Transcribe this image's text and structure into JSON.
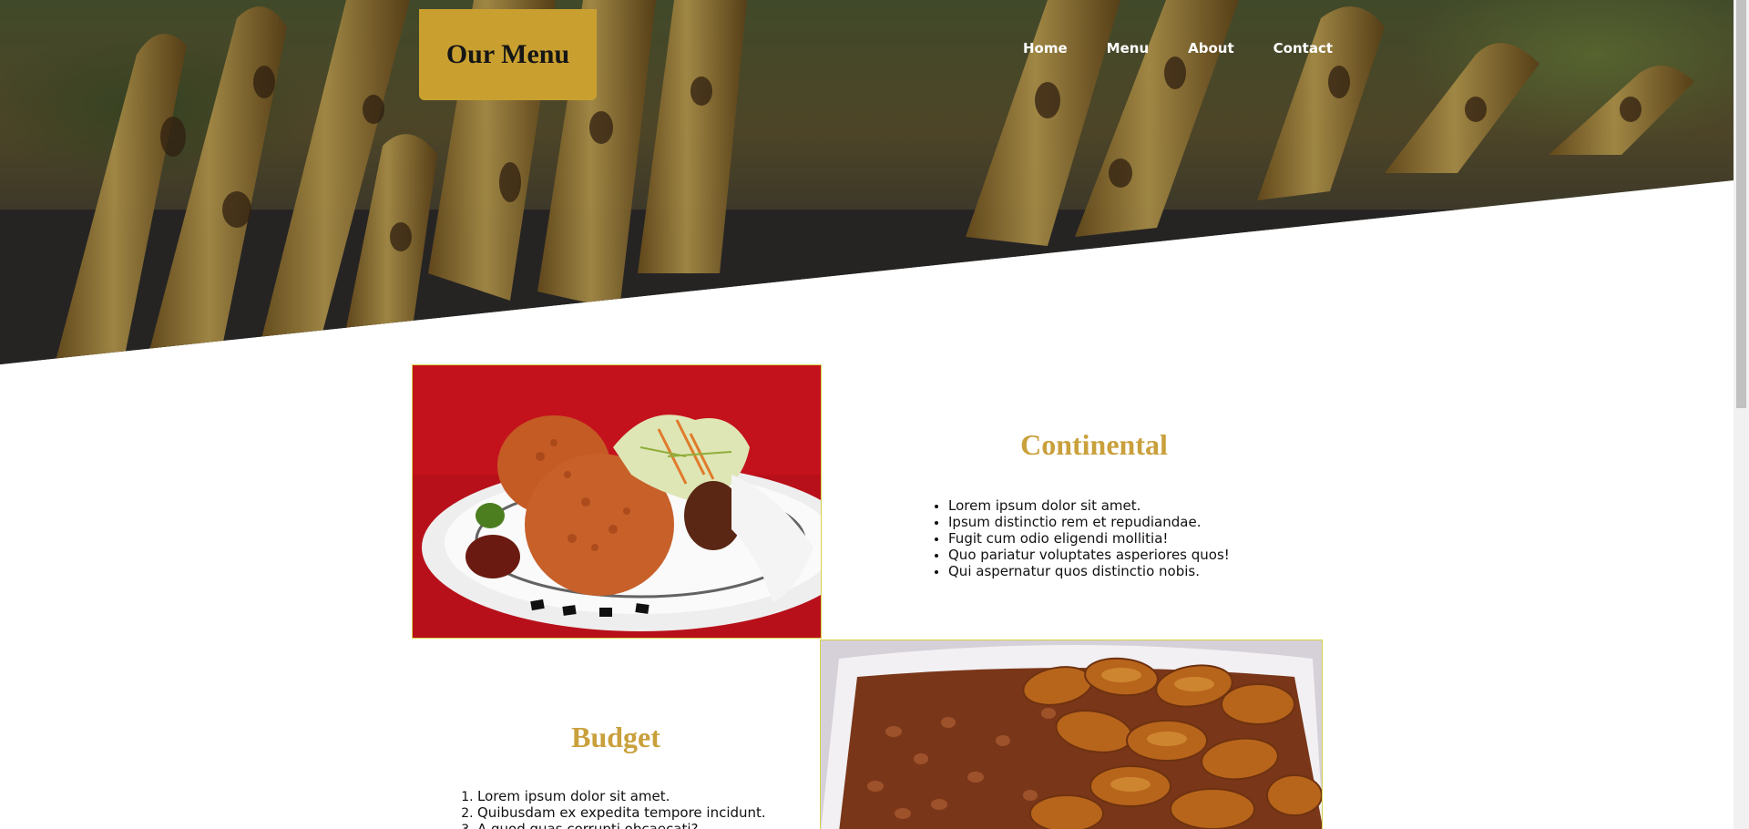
{
  "header": {
    "logo_text": "Our Menu",
    "nav": [
      "Home",
      "Menu",
      "About",
      "Contact"
    ]
  },
  "hero": {
    "image": "grilled-plantain-banner"
  },
  "sections": [
    {
      "title": "Continental",
      "image": "jollof-rice-plate",
      "list_style": "bulleted",
      "items": [
        "Lorem ipsum dolor sit amet.",
        "Ipsum distinctio rem et repudiandae.",
        "Fugit cum odio eligendi mollitia!",
        "Quo pariatur voluptates asperiores quos!",
        "Qui aspernatur quos distinctio nobis."
      ]
    },
    {
      "title": "Budget",
      "image": "beans-and-plantain-dish",
      "list_style": "numbered",
      "items": [
        "Lorem ipsum dolor sit amet.",
        "Quibusdam ex expedita tempore incidunt.",
        "A quod quas corrupti obcaecati?"
      ]
    }
  ],
  "colors": {
    "accent_gold": "#c9a030",
    "title_gold": "#c9a03c",
    "image_border": "#d8d24a",
    "nav_text": "#ffffff"
  }
}
